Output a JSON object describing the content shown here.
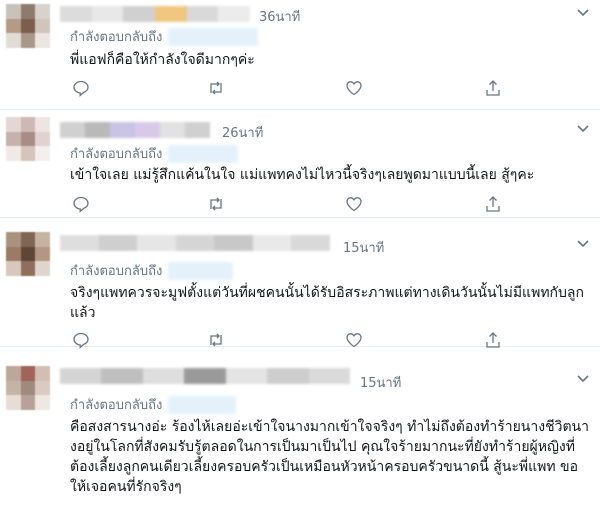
{
  "tweets": [
    {
      "time": "36นาที",
      "reply_label": "กำลังตอบกลับถึง",
      "text": "พี่แอฟก็คือให้กำลังใจดีมากๆค่ะ",
      "avatar_colors": [
        "#c9c2bb",
        "#8d7c6e",
        "#d8d2cc",
        "#b59a86",
        "#7b5f4c",
        "#cfc5bb",
        "#e2dcd6",
        "#a8988a",
        "#ebe6e1"
      ],
      "name_colors": [
        "#dcdcdc",
        "#e8e8e8",
        "#d0d0d0",
        "#f1c680",
        "#d9d9d9",
        "#ececec"
      ]
    },
    {
      "time": "26นาที",
      "reply_label": "กำลังตอบกลับถึง",
      "text": "เข้าใจเลย แม่รู้สึกแค้นในใจ แม่แพทคงไม่ไหวนี้จริงๆเลยพูดมาแบบนี้เลย สู้ๆคะ",
      "avatar_colors": [
        "#e3d6d3",
        "#cdb9b4",
        "#eee5e3",
        "#c7b1ac",
        "#a88c86",
        "#e0d2cf",
        "#f0e9e7",
        "#d4c3bf",
        "#f4eeec"
      ],
      "name_colors": [
        "#d0d0d0",
        "#b9b9b9",
        "#c9c3e6",
        "#d8c9e8",
        "#e1e1e1",
        "#cfcfcf"
      ]
    },
    {
      "time": "15นาที",
      "reply_label": "กำลังตอบกลับถึง",
      "text": "จริงๆแพทควรจะมูฟตั้งแต่วันที่ผชคนนั้นได้รับอิสระภาพแต่ทางเดินวันนั้นไม่มีแพทกับลูกแล้ว",
      "avatar_colors": [
        "#a99380",
        "#806554",
        "#c4b2a3",
        "#9c7b66",
        "#5f4536",
        "#b49783",
        "#d6c8bd",
        "#8f6f5c",
        "#e0d5cc"
      ],
      "name_colors": [
        "#dedede",
        "#cfcfcf",
        "#e6e6e6",
        "#d5d5d5",
        "#c8c8c8",
        "#e9e9e9",
        "#d9d9d9"
      ]
    },
    {
      "time": "15นาที",
      "reply_label": "กำลังตอบกลับถึง",
      "text": "คือสงสารนางอ่ะ ร้องไห้เลยอ่ะเข้าใจนางมากเข้าใจจริงๆ ทำไม่ถึงต้องทำร้ายนางชีวิตนางอยู่ในโลกที่สังคมรับรู้ตลอดในการเป็นมาเป็นไป คุณใจร้ายมากนะที่ยังทำร้ายผู้หญิงที่ต้องเลี้ยงลูกคนเดียวเลี้ยงครอบครัวเป็นเหมือนหัวหน้าครอบครัวขนาดนี้ สู้นะพี่แพท ขอให้เจอคนที่รักจริงๆ",
      "avatar_colors": [
        "#bda79b",
        "#a0645a",
        "#d1bfb4",
        "#c5b3a8",
        "#9e8a7e",
        "#dacbc2",
        "#e8ddd6",
        "#b8a297",
        "#efe7e2"
      ],
      "name_colors": [
        "#d4d4d4",
        "#bfbfbf",
        "#dedede",
        "#9a9a9a",
        "#e4e4e4",
        "#cdcdcd",
        "#dadada"
      ]
    }
  ]
}
